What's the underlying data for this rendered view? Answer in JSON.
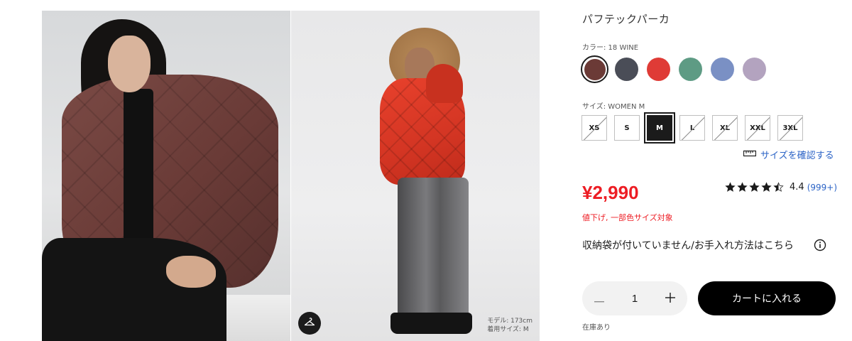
{
  "gallery": {
    "model_info_line1": "モデル: 173cm",
    "model_info_line2": "着用サイズ: M"
  },
  "product": {
    "name": "パフテックパーカ",
    "color_label": "カラー: 18 WINE",
    "colors": [
      {
        "hex": "#6b3a36",
        "selected": true
      },
      {
        "hex": "#4a4d57",
        "selected": false
      },
      {
        "hex": "#df3b36",
        "selected": false
      },
      {
        "hex": "#5e9b84",
        "selected": false
      },
      {
        "hex": "#7a90c4",
        "selected": false
      },
      {
        "hex": "#b3a3bf",
        "selected": false
      }
    ],
    "size_label": "サイズ: WOMEN M",
    "sizes": [
      {
        "label": "XS",
        "state": "unavailable"
      },
      {
        "label": "S",
        "state": "available"
      },
      {
        "label": "M",
        "state": "selected"
      },
      {
        "label": "L",
        "state": "unavailable"
      },
      {
        "label": "XL",
        "state": "unavailable"
      },
      {
        "label": "XXL",
        "state": "unavailable"
      },
      {
        "label": "3XL",
        "state": "unavailable"
      }
    ],
    "size_guide": "サイズを確認する",
    "price": "¥2,990",
    "rating": {
      "stars": 4.5,
      "value": "4.4",
      "count": "(999+)"
    },
    "sale_note": "値下げ, 一部色サイズ対象",
    "care_link": "収納袋が付いていません/お手入れ方法はこちら",
    "quantity": "1",
    "add_to_cart": "カートに入れる",
    "stock": "在庫あり"
  }
}
